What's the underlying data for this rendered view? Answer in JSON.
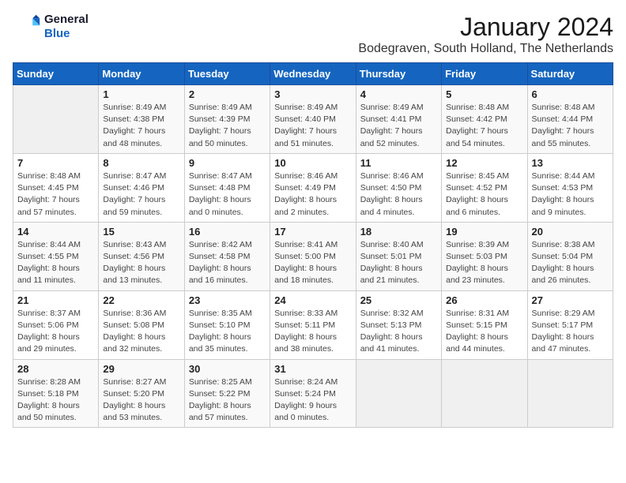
{
  "header": {
    "logo_line1": "General",
    "logo_line2": "Blue",
    "month": "January 2024",
    "location": "Bodegraven, South Holland, The Netherlands"
  },
  "weekdays": [
    "Sunday",
    "Monday",
    "Tuesday",
    "Wednesday",
    "Thursday",
    "Friday",
    "Saturday"
  ],
  "weeks": [
    [
      {
        "day": "",
        "info": ""
      },
      {
        "day": "1",
        "info": "Sunrise: 8:49 AM\nSunset: 4:38 PM\nDaylight: 7 hours\nand 48 minutes."
      },
      {
        "day": "2",
        "info": "Sunrise: 8:49 AM\nSunset: 4:39 PM\nDaylight: 7 hours\nand 50 minutes."
      },
      {
        "day": "3",
        "info": "Sunrise: 8:49 AM\nSunset: 4:40 PM\nDaylight: 7 hours\nand 51 minutes."
      },
      {
        "day": "4",
        "info": "Sunrise: 8:49 AM\nSunset: 4:41 PM\nDaylight: 7 hours\nand 52 minutes."
      },
      {
        "day": "5",
        "info": "Sunrise: 8:48 AM\nSunset: 4:42 PM\nDaylight: 7 hours\nand 54 minutes."
      },
      {
        "day": "6",
        "info": "Sunrise: 8:48 AM\nSunset: 4:44 PM\nDaylight: 7 hours\nand 55 minutes."
      }
    ],
    [
      {
        "day": "7",
        "info": "Sunrise: 8:48 AM\nSunset: 4:45 PM\nDaylight: 7 hours\nand 57 minutes."
      },
      {
        "day": "8",
        "info": "Sunrise: 8:47 AM\nSunset: 4:46 PM\nDaylight: 7 hours\nand 59 minutes."
      },
      {
        "day": "9",
        "info": "Sunrise: 8:47 AM\nSunset: 4:48 PM\nDaylight: 8 hours\nand 0 minutes."
      },
      {
        "day": "10",
        "info": "Sunrise: 8:46 AM\nSunset: 4:49 PM\nDaylight: 8 hours\nand 2 minutes."
      },
      {
        "day": "11",
        "info": "Sunrise: 8:46 AM\nSunset: 4:50 PM\nDaylight: 8 hours\nand 4 minutes."
      },
      {
        "day": "12",
        "info": "Sunrise: 8:45 AM\nSunset: 4:52 PM\nDaylight: 8 hours\nand 6 minutes."
      },
      {
        "day": "13",
        "info": "Sunrise: 8:44 AM\nSunset: 4:53 PM\nDaylight: 8 hours\nand 9 minutes."
      }
    ],
    [
      {
        "day": "14",
        "info": "Sunrise: 8:44 AM\nSunset: 4:55 PM\nDaylight: 8 hours\nand 11 minutes."
      },
      {
        "day": "15",
        "info": "Sunrise: 8:43 AM\nSunset: 4:56 PM\nDaylight: 8 hours\nand 13 minutes."
      },
      {
        "day": "16",
        "info": "Sunrise: 8:42 AM\nSunset: 4:58 PM\nDaylight: 8 hours\nand 16 minutes."
      },
      {
        "day": "17",
        "info": "Sunrise: 8:41 AM\nSunset: 5:00 PM\nDaylight: 8 hours\nand 18 minutes."
      },
      {
        "day": "18",
        "info": "Sunrise: 8:40 AM\nSunset: 5:01 PM\nDaylight: 8 hours\nand 21 minutes."
      },
      {
        "day": "19",
        "info": "Sunrise: 8:39 AM\nSunset: 5:03 PM\nDaylight: 8 hours\nand 23 minutes."
      },
      {
        "day": "20",
        "info": "Sunrise: 8:38 AM\nSunset: 5:04 PM\nDaylight: 8 hours\nand 26 minutes."
      }
    ],
    [
      {
        "day": "21",
        "info": "Sunrise: 8:37 AM\nSunset: 5:06 PM\nDaylight: 8 hours\nand 29 minutes."
      },
      {
        "day": "22",
        "info": "Sunrise: 8:36 AM\nSunset: 5:08 PM\nDaylight: 8 hours\nand 32 minutes."
      },
      {
        "day": "23",
        "info": "Sunrise: 8:35 AM\nSunset: 5:10 PM\nDaylight: 8 hours\nand 35 minutes."
      },
      {
        "day": "24",
        "info": "Sunrise: 8:33 AM\nSunset: 5:11 PM\nDaylight: 8 hours\nand 38 minutes."
      },
      {
        "day": "25",
        "info": "Sunrise: 8:32 AM\nSunset: 5:13 PM\nDaylight: 8 hours\nand 41 minutes."
      },
      {
        "day": "26",
        "info": "Sunrise: 8:31 AM\nSunset: 5:15 PM\nDaylight: 8 hours\nand 44 minutes."
      },
      {
        "day": "27",
        "info": "Sunrise: 8:29 AM\nSunset: 5:17 PM\nDaylight: 8 hours\nand 47 minutes."
      }
    ],
    [
      {
        "day": "28",
        "info": "Sunrise: 8:28 AM\nSunset: 5:18 PM\nDaylight: 8 hours\nand 50 minutes."
      },
      {
        "day": "29",
        "info": "Sunrise: 8:27 AM\nSunset: 5:20 PM\nDaylight: 8 hours\nand 53 minutes."
      },
      {
        "day": "30",
        "info": "Sunrise: 8:25 AM\nSunset: 5:22 PM\nDaylight: 8 hours\nand 57 minutes."
      },
      {
        "day": "31",
        "info": "Sunrise: 8:24 AM\nSunset: 5:24 PM\nDaylight: 9 hours\nand 0 minutes."
      },
      {
        "day": "",
        "info": ""
      },
      {
        "day": "",
        "info": ""
      },
      {
        "day": "",
        "info": ""
      }
    ]
  ]
}
